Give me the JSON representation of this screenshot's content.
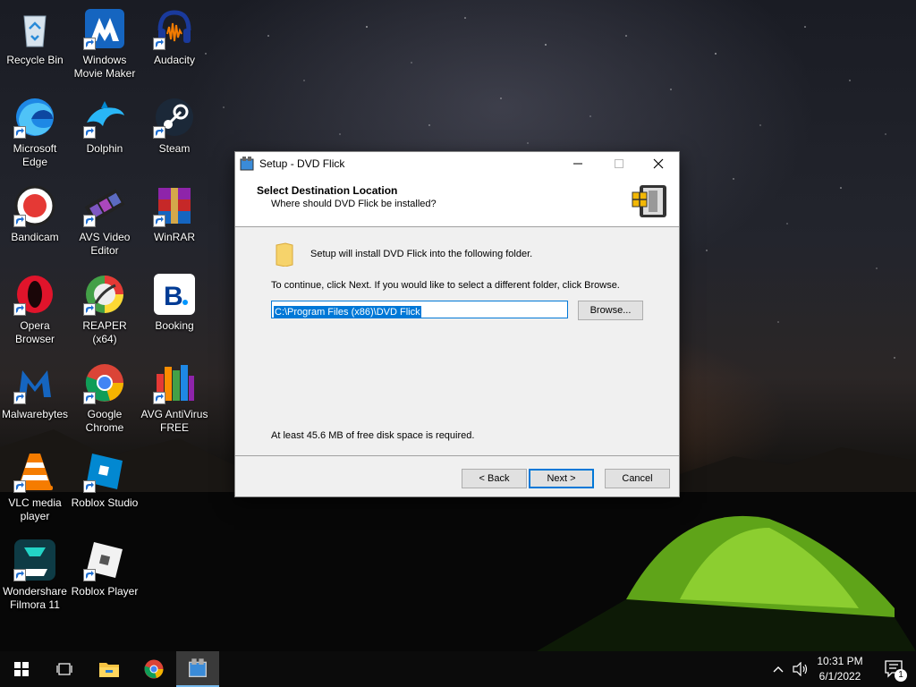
{
  "desktop": {
    "icons": [
      {
        "name": "recycle-bin",
        "label": "Recycle Bin"
      },
      {
        "name": "windows-movie-maker",
        "label": "Windows Movie Maker"
      },
      {
        "name": "audacity",
        "label": "Audacity"
      },
      {
        "name": "microsoft-edge",
        "label": "Microsoft Edge"
      },
      {
        "name": "dolphin",
        "label": "Dolphin"
      },
      {
        "name": "steam",
        "label": "Steam"
      },
      {
        "name": "bandicam",
        "label": "Bandicam"
      },
      {
        "name": "avs-video-editor",
        "label": "AVS Video Editor"
      },
      {
        "name": "winrar",
        "label": "WinRAR"
      },
      {
        "name": "opera-browser",
        "label": "Opera Browser"
      },
      {
        "name": "reaper",
        "label": "REAPER (x64)"
      },
      {
        "name": "booking",
        "label": "Booking"
      },
      {
        "name": "malwarebytes",
        "label": "Malwarebytes"
      },
      {
        "name": "google-chrome",
        "label": "Google Chrome"
      },
      {
        "name": "avg-antivirus",
        "label": "AVG AntiVirus FREE"
      },
      {
        "name": "vlc-media-player",
        "label": "VLC media player"
      },
      {
        "name": "roblox-studio",
        "label": "Roblox Studio"
      },
      {
        "name": "wondershare-filmora",
        "label": "Wondershare Filmora 11"
      },
      {
        "name": "roblox-player",
        "label": "Roblox Player"
      }
    ]
  },
  "dialog": {
    "window_title": "Setup - DVD Flick",
    "header_title": "Select Destination Location",
    "header_subtitle": "Where should DVD Flick be installed?",
    "install_text": "Setup will install DVD Flick into the following folder.",
    "continue_text": "To continue, click Next. If you would like to select a different folder, click Browse.",
    "path_value": "C:\\Program Files (x86)\\DVD Flick",
    "browse_label": "Browse...",
    "disk_space_text": "At least 45.6 MB of free disk space is required.",
    "back_label": "< Back",
    "next_label": "Next >",
    "cancel_label": "Cancel"
  },
  "taskbar": {
    "time": "10:31 PM",
    "date": "6/1/2022",
    "notification_count": "1"
  }
}
